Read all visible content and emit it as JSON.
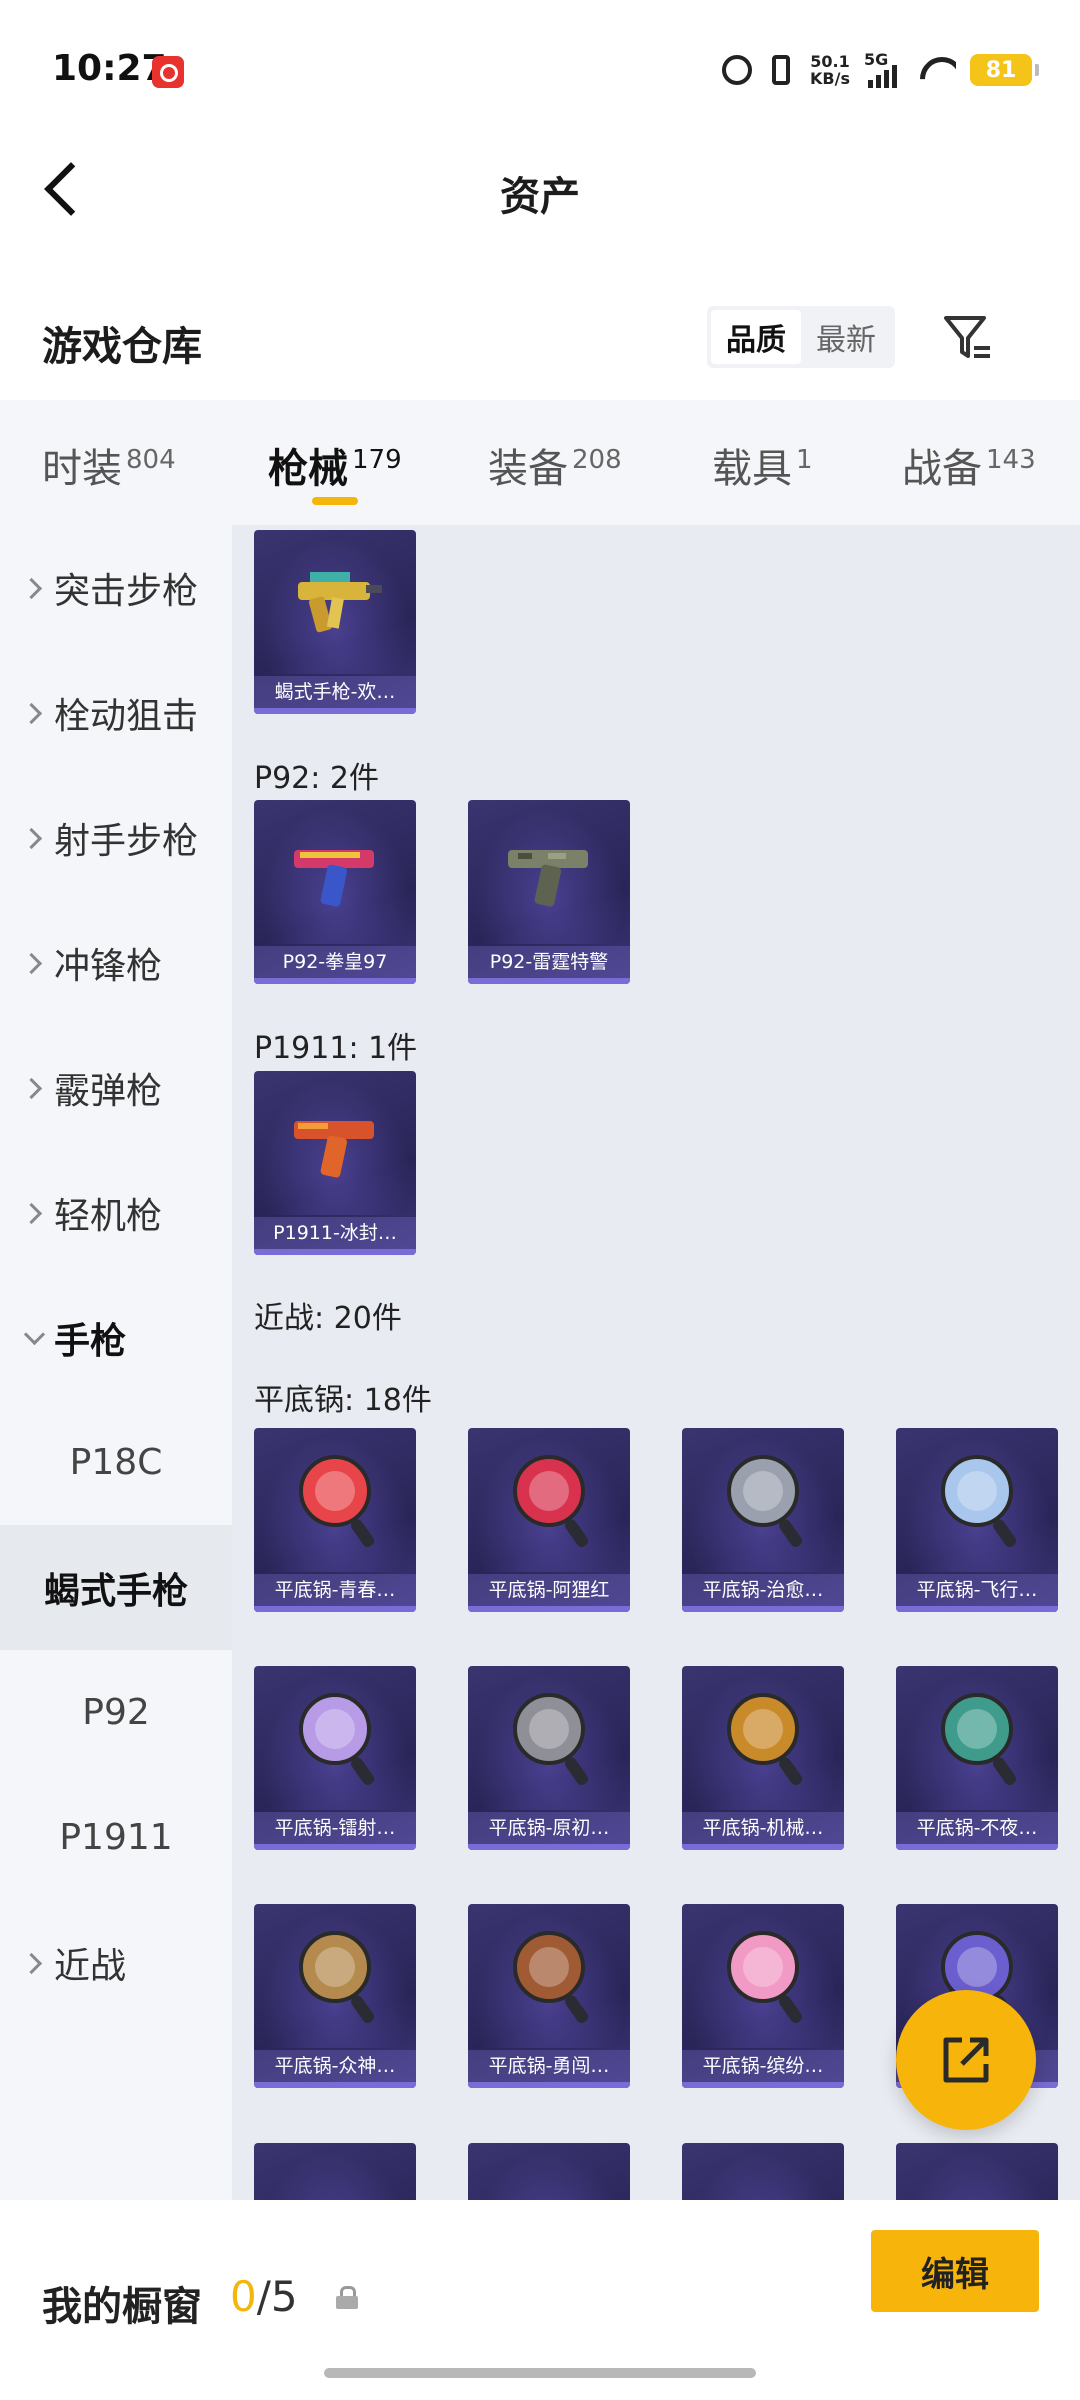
{
  "status_bar": {
    "time": "10:27",
    "net_speed_value": "50.1",
    "net_speed_unit": "KB/s",
    "network": "5G",
    "battery": "81"
  },
  "header": {
    "title": "资产"
  },
  "section": {
    "title": "游戏仓库",
    "sort_options": [
      "品质",
      "最新"
    ],
    "active_sort": "品质"
  },
  "category_tabs": [
    {
      "label": "时装",
      "count": "804"
    },
    {
      "label": "枪械",
      "count": "179"
    },
    {
      "label": "装备",
      "count": "208"
    },
    {
      "label": "载具",
      "count": "1"
    },
    {
      "label": "战备",
      "count": "143"
    }
  ],
  "active_tab": "枪械",
  "sidebar": {
    "items": [
      {
        "label": "突击步枪",
        "type": "collapsed"
      },
      {
        "label": "栓动狙击",
        "type": "collapsed"
      },
      {
        "label": "射手步枪",
        "type": "collapsed"
      },
      {
        "label": "冲锋枪",
        "type": "collapsed"
      },
      {
        "label": "霰弹枪",
        "type": "collapsed"
      },
      {
        "label": "轻机枪",
        "type": "collapsed"
      },
      {
        "label": "手枪",
        "type": "expanded"
      },
      {
        "label": "P18C",
        "type": "sub"
      },
      {
        "label": "蝎式手枪",
        "type": "sub-selected"
      },
      {
        "label": "P92",
        "type": "sub"
      },
      {
        "label": "P1911",
        "type": "sub"
      },
      {
        "label": "近战",
        "type": "collapsed"
      }
    ]
  },
  "content": {
    "top_cards": [
      {
        "name": "蝎式手枪-欢…",
        "icon": "smg-gold-icon"
      }
    ],
    "groups": [
      {
        "label": "P92: 2件",
        "items": [
          {
            "name": "P92-拳皇97",
            "icon": "pistol-colorful-icon"
          },
          {
            "name": "P92-雷霆特警",
            "icon": "pistol-camo-icon"
          }
        ]
      },
      {
        "label": "P1911: 1件",
        "items": [
          {
            "name": "P1911-冰封…",
            "icon": "pistol-orange-icon"
          }
        ]
      }
    ],
    "melee_label": "近战: 20件",
    "pan_label": "平底锅: 18件",
    "pans": [
      {
        "name": "平底锅-青春…",
        "color": "#e8454a"
      },
      {
        "name": "平底锅-阿狸红",
        "color": "#d8324f"
      },
      {
        "name": "平底锅-治愈…",
        "color": "#9aa0ad"
      },
      {
        "name": "平底锅-飞行…",
        "color": "#a9c6ec"
      },
      {
        "name": "平底锅-镭射…",
        "color": "#b79be6"
      },
      {
        "name": "平底锅-原初…",
        "color": "#8f8f98"
      },
      {
        "name": "平底锅-机械…",
        "color": "#c98a2a"
      },
      {
        "name": "平底锅-不夜…",
        "color": "#3f9c8d"
      },
      {
        "name": "平底锅-众神…",
        "color": "#b58a4e"
      },
      {
        "name": "平底锅-勇闯…",
        "color": "#a05b35"
      },
      {
        "name": "平底锅-缤纷…",
        "color": "#f29ac6"
      },
      {
        "name": "…",
        "color": "#6b5fd0"
      }
    ]
  },
  "bottom": {
    "window_label": "我的橱窗",
    "window_used": "0",
    "window_total": "/5",
    "edit_label": "编辑"
  }
}
